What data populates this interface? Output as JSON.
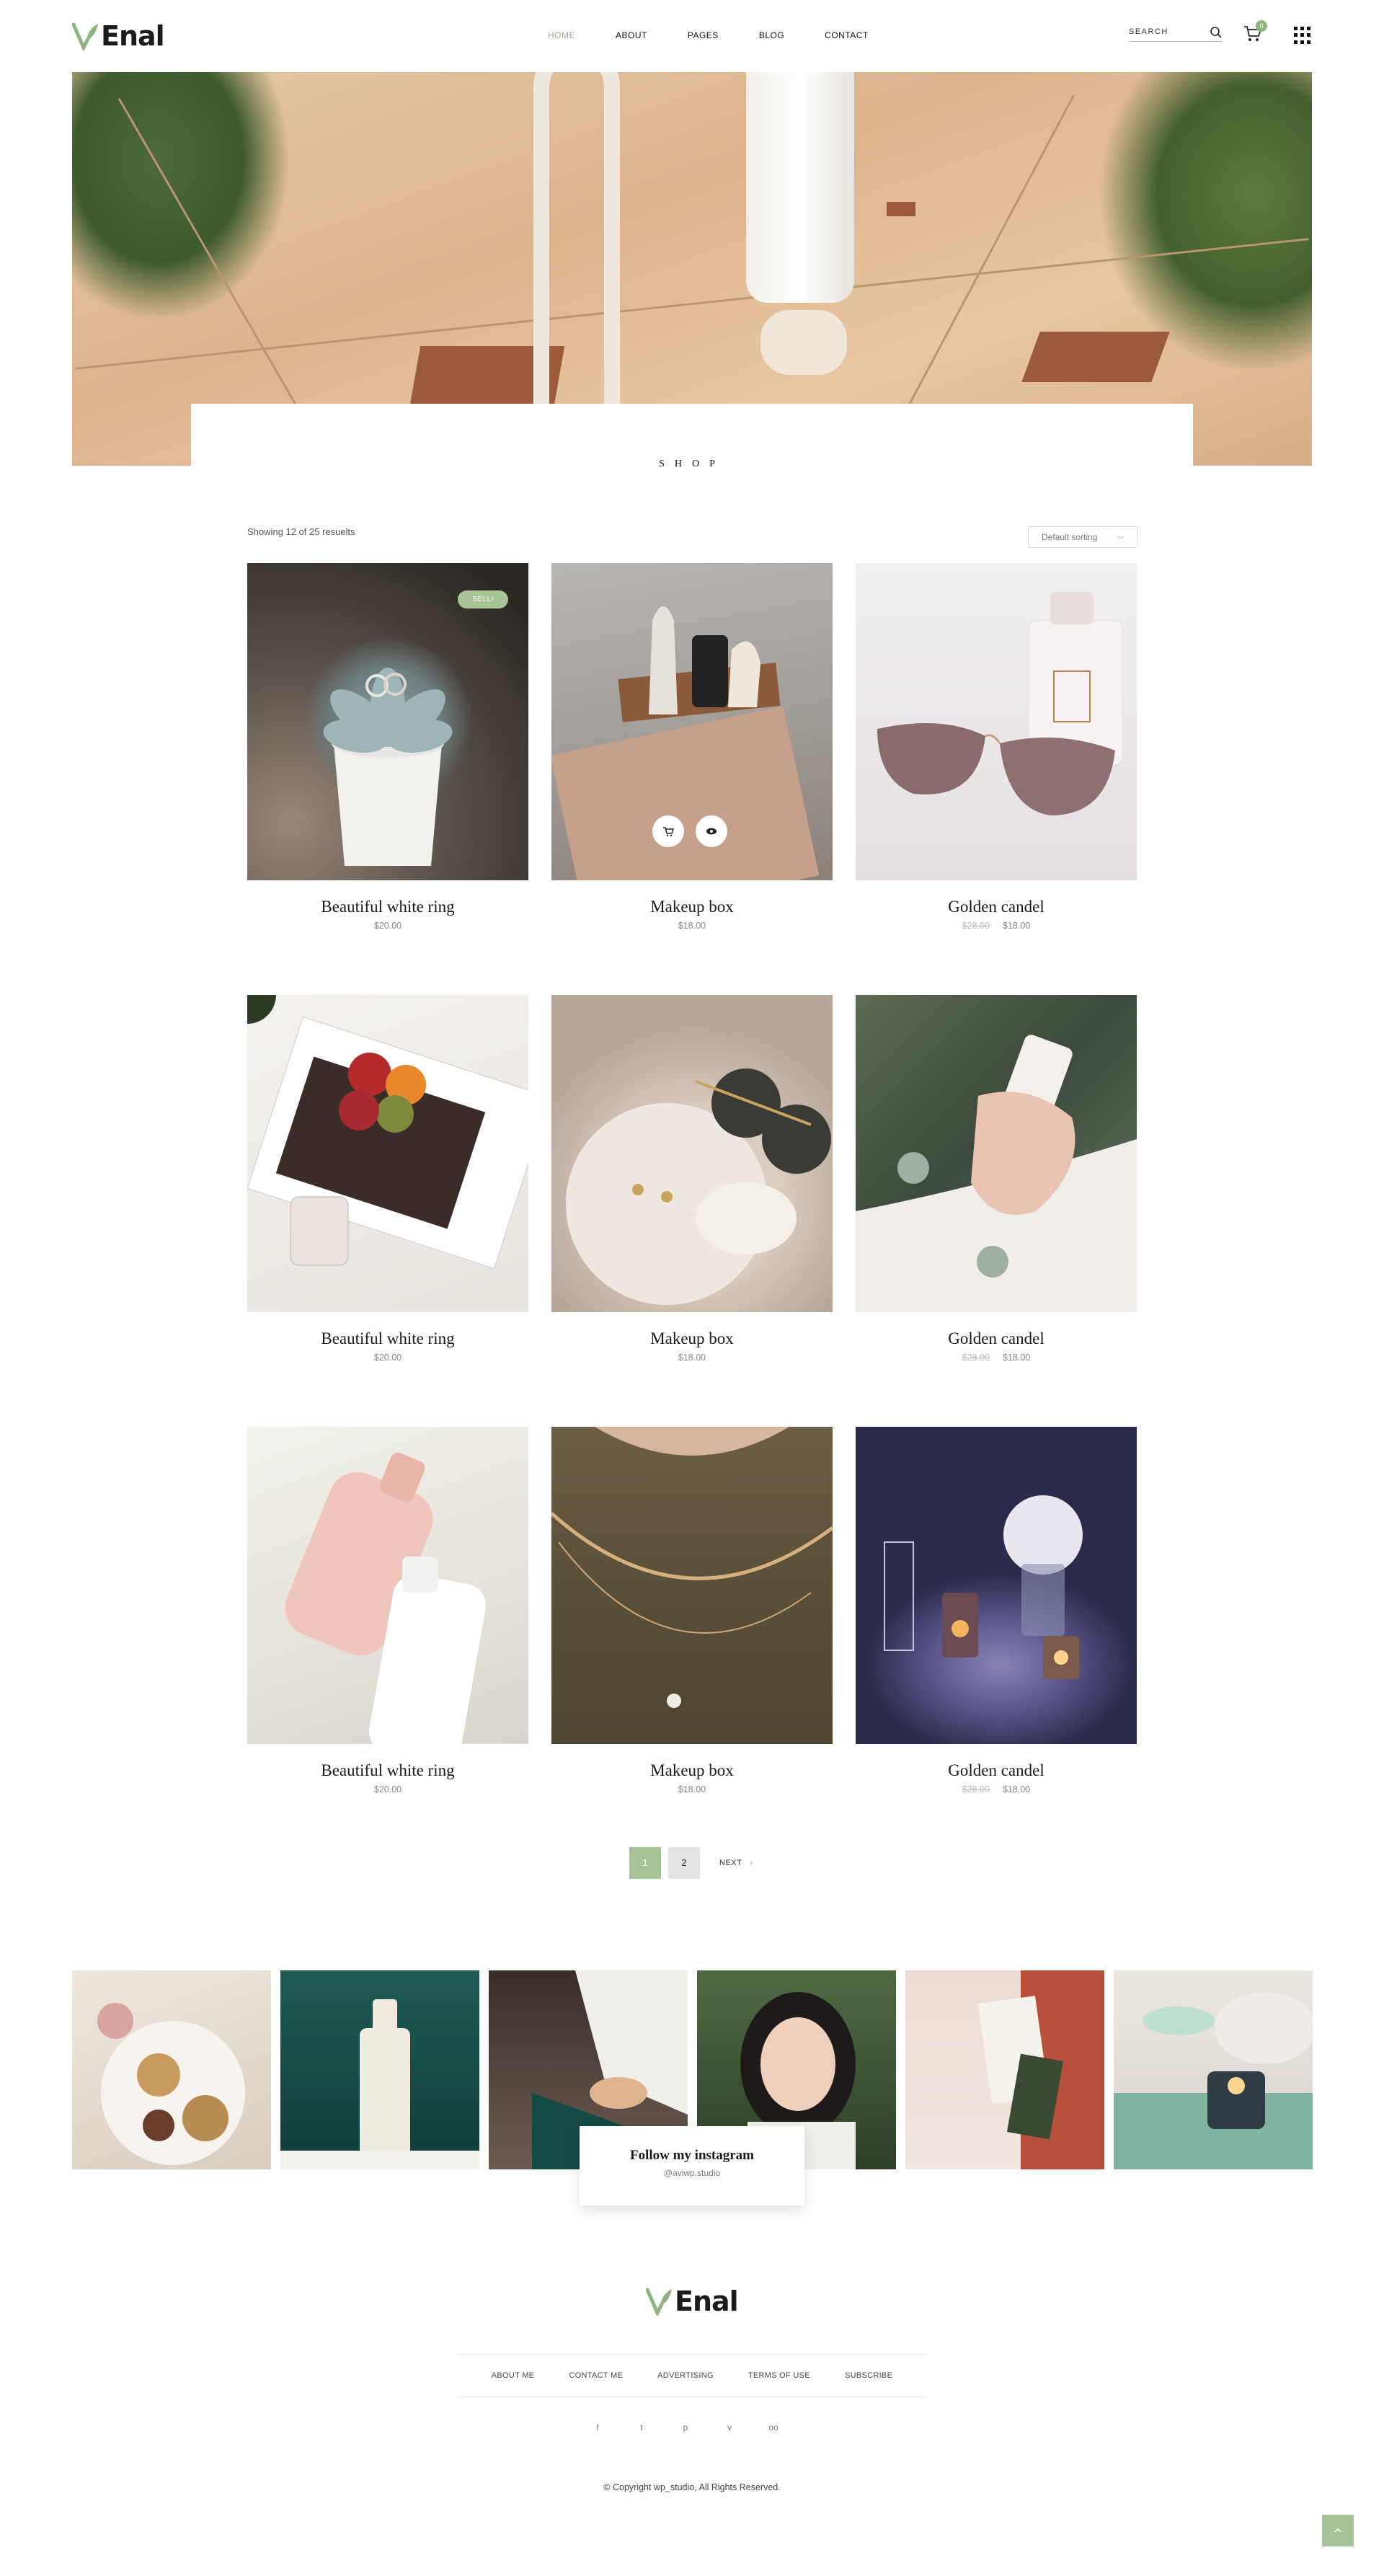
{
  "brand": {
    "name": "Enal",
    "accent_color": "#8fb47e"
  },
  "nav": {
    "items": [
      {
        "label": "HOME",
        "active": true
      },
      {
        "label": "ABOUT",
        "active": false
      },
      {
        "label": "PAGES",
        "active": false
      },
      {
        "label": "BLOG",
        "active": false
      },
      {
        "label": "CONTACT",
        "active": false
      }
    ]
  },
  "header": {
    "search_label": "SEARCH",
    "search_icon": "search-icon",
    "cart_icon": "cart-icon",
    "cart_count": "0",
    "menu_icon": "grid-menu-icon"
  },
  "hero": {
    "title": "SHOP"
  },
  "shop": {
    "results_text": "Showing 12 of 25 resuelts",
    "sort_selected": "Default sorting"
  },
  "products": [
    {
      "name": "Beautiful white ring",
      "price": "$20.00",
      "old_price": "",
      "badge": "SELL!"
    },
    {
      "name": "Makeup box",
      "price": "$18.00",
      "old_price": "",
      "badge": ""
    },
    {
      "name": "Golden candel",
      "price": "$18.00",
      "old_price": "$28.00",
      "badge": ""
    },
    {
      "name": "Beautiful white ring",
      "price": "$20.00",
      "old_price": "",
      "badge": ""
    },
    {
      "name": "Makeup box",
      "price": "$18.00",
      "old_price": "",
      "badge": ""
    },
    {
      "name": "Golden candel",
      "price": "$18.00",
      "old_price": "$28.00",
      "badge": ""
    },
    {
      "name": "Beautiful white ring",
      "price": "$20.00",
      "old_price": "",
      "badge": ""
    },
    {
      "name": "Makeup box",
      "price": "$18.00",
      "old_price": "",
      "badge": ""
    },
    {
      "name": "Golden candel",
      "price": "$18.00",
      "old_price": "$28.00",
      "badge": ""
    }
  ],
  "pagination": {
    "pages": [
      "1",
      "2"
    ],
    "current": "1",
    "next_label": "NEXT"
  },
  "instagram": {
    "title": "Follow my instagram",
    "handle": "@aviwp.studio"
  },
  "footer": {
    "links": [
      "ABOUT ME",
      "CONTACT ME",
      "ADVERTISING",
      "TERMS OF USE",
      "SUBSCRIBE"
    ],
    "social_icons": [
      "facebook-icon",
      "twitter-icon",
      "pinterest-icon",
      "vimeo-icon",
      "tripadvisor-icon"
    ],
    "social_glyphs": [
      "f",
      "t",
      "p",
      "v",
      "oo"
    ],
    "copyright": "© Copyright wp_studio, All Rights Reserved.",
    "top_icon": "arrow-up-icon"
  }
}
